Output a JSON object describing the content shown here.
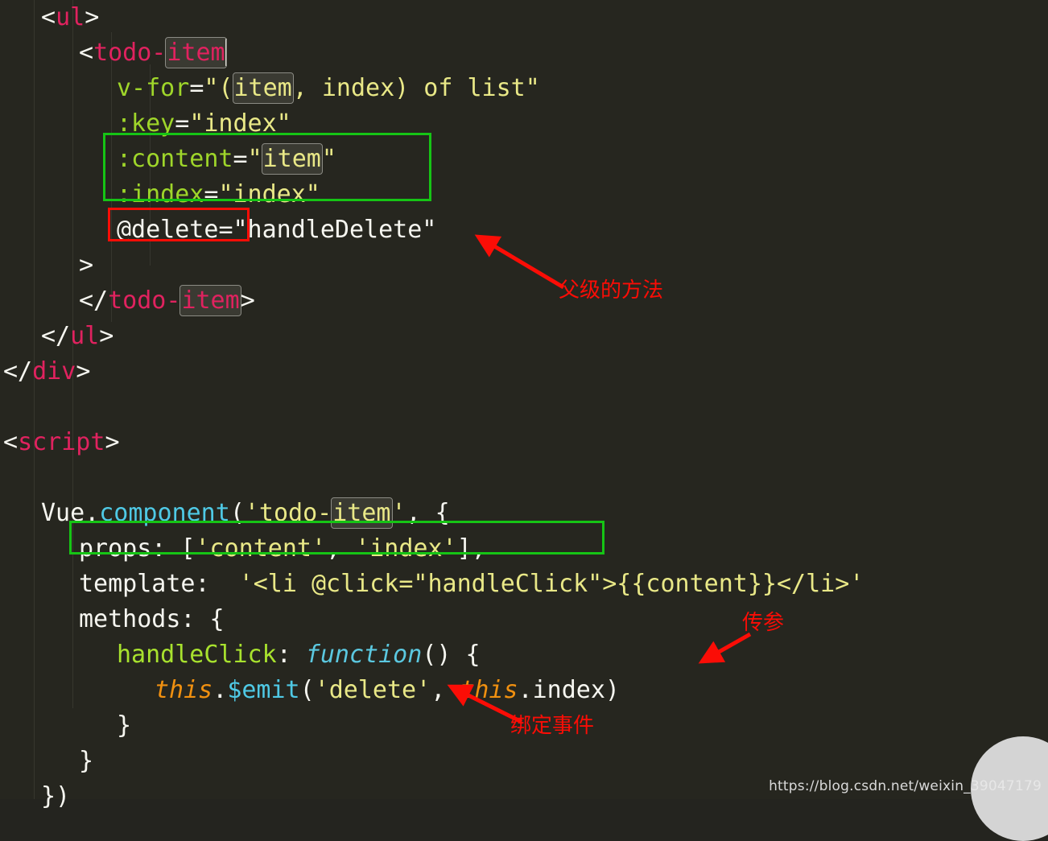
{
  "editor": {
    "background_hex": "#26261f",
    "font_size_px": 30,
    "line_height_px": 44,
    "caret_after_token": "todo-item",
    "occurrence_highlight_token": "item"
  },
  "colors": {
    "tag": "#e0225f",
    "attribute": "#9fd62a",
    "string": "#e9e887",
    "plain": "#f6f6f0",
    "function": "#5fd7e8",
    "keyword_function": "#5bc8e0",
    "this_keyword": "#f09010",
    "method_name": "#a8e22e",
    "annotation_red": "#fb0d06",
    "annotation_green": "#16c415"
  },
  "code_lines": [
    {
      "id": "l1",
      "indent": 1,
      "segments": [
        {
          "t": "<",
          "c": "punc"
        },
        {
          "t": "ul",
          "c": "tag"
        },
        {
          "t": ">",
          "c": "punc"
        }
      ]
    },
    {
      "id": "l2",
      "indent": 2,
      "segments": [
        {
          "t": "<",
          "c": "punc"
        },
        {
          "t": "todo-",
          "c": "tag"
        },
        {
          "t": "item",
          "c": "tag",
          "occ": true
        },
        {
          "t": "|caret|",
          "c": "caret"
        }
      ]
    },
    {
      "id": "l3",
      "indent": 3,
      "segments": [
        {
          "t": "v-for",
          "c": "attr"
        },
        {
          "t": "=",
          "c": "plain"
        },
        {
          "t": "\"(",
          "c": "str"
        },
        {
          "t": "item",
          "c": "str",
          "occ": true
        },
        {
          "t": ", index) of list\"",
          "c": "str"
        }
      ]
    },
    {
      "id": "l4",
      "indent": 3,
      "segments": [
        {
          "t": ":key",
          "c": "attr"
        },
        {
          "t": "=",
          "c": "plain"
        },
        {
          "t": "\"index\"",
          "c": "str"
        }
      ]
    },
    {
      "id": "l5",
      "indent": 3,
      "segments": [
        {
          "t": ":content",
          "c": "attr"
        },
        {
          "t": "=",
          "c": "plain"
        },
        {
          "t": "\"",
          "c": "str"
        },
        {
          "t": "item",
          "c": "str",
          "occ": true
        },
        {
          "t": "\"",
          "c": "str"
        }
      ]
    },
    {
      "id": "l6",
      "indent": 3,
      "segments": [
        {
          "t": ":index",
          "c": "attr"
        },
        {
          "t": "=",
          "c": "plain"
        },
        {
          "t": "\"index\"",
          "c": "str"
        }
      ]
    },
    {
      "id": "l7",
      "indent": 3,
      "segments": [
        {
          "t": "@delete",
          "c": "plain"
        },
        {
          "t": "=\"handleDelete\"",
          "c": "plain"
        }
      ]
    },
    {
      "id": "l8",
      "indent": 2,
      "segments": [
        {
          "t": ">",
          "c": "punc"
        }
      ]
    },
    {
      "id": "l9",
      "indent": 2,
      "segments": [
        {
          "t": "</",
          "c": "punc"
        },
        {
          "t": "todo-",
          "c": "tag"
        },
        {
          "t": "item",
          "c": "tag",
          "occ": true
        },
        {
          "t": ">",
          "c": "punc"
        }
      ]
    },
    {
      "id": "l10",
      "indent": 1,
      "segments": [
        {
          "t": "</",
          "c": "punc"
        },
        {
          "t": "ul",
          "c": "tag"
        },
        {
          "t": ">",
          "c": "punc"
        }
      ]
    },
    {
      "id": "l11",
      "indent": 0,
      "segments": [
        {
          "t": "</",
          "c": "punc"
        },
        {
          "t": "div",
          "c": "tag"
        },
        {
          "t": ">",
          "c": "punc"
        }
      ]
    },
    {
      "id": "l12",
      "indent": 0,
      "segments": []
    },
    {
      "id": "l13",
      "indent": 0,
      "segments": [
        {
          "t": "<",
          "c": "punc"
        },
        {
          "t": "script",
          "c": "tag"
        },
        {
          "t": ">",
          "c": "punc"
        }
      ]
    },
    {
      "id": "l14",
      "indent": 0,
      "segments": []
    },
    {
      "id": "l15",
      "indent": 1,
      "segments": [
        {
          "t": "Vue",
          "c": "plain"
        },
        {
          "t": ".",
          "c": "plain"
        },
        {
          "t": "component",
          "c": "cyan"
        },
        {
          "t": "(",
          "c": "plain"
        },
        {
          "t": "'todo-",
          "c": "str"
        },
        {
          "t": "item",
          "c": "str",
          "occ": true
        },
        {
          "t": "'",
          "c": "str"
        },
        {
          "t": ", {",
          "c": "plain"
        }
      ]
    },
    {
      "id": "l16",
      "indent": 2,
      "segments": [
        {
          "t": "props: ",
          "c": "plain"
        },
        {
          "t": "[",
          "c": "plain"
        },
        {
          "t": "'content'",
          "c": "str"
        },
        {
          "t": ", ",
          "c": "plain"
        },
        {
          "t": "'index'",
          "c": "str"
        },
        {
          "t": "],",
          "c": "plain"
        }
      ]
    },
    {
      "id": "l17",
      "indent": 2,
      "segments": [
        {
          "t": "template:  ",
          "c": "plain"
        },
        {
          "t": "'<li @click=\"handleClick\">{{content}}</li>'",
          "c": "str"
        }
      ]
    },
    {
      "id": "l18",
      "indent": 2,
      "segments": [
        {
          "t": "methods: {",
          "c": "plain"
        }
      ]
    },
    {
      "id": "l19",
      "indent": 3,
      "segments": [
        {
          "t": "handleClick",
          "c": "method"
        },
        {
          "t": ": ",
          "c": "plain"
        },
        {
          "t": "function",
          "c": "kw-fn"
        },
        {
          "t": "() {",
          "c": "plain"
        }
      ]
    },
    {
      "id": "l20",
      "indent": 4,
      "segments": [
        {
          "t": "this",
          "c": "this"
        },
        {
          "t": ".",
          "c": "plain"
        },
        {
          "t": "$emit",
          "c": "cyan"
        },
        {
          "t": "(",
          "c": "plain"
        },
        {
          "t": "'delete'",
          "c": "str"
        },
        {
          "t": ", ",
          "c": "plain"
        },
        {
          "t": "this",
          "c": "this"
        },
        {
          "t": ".index)",
          "c": "plain"
        }
      ]
    },
    {
      "id": "l21",
      "indent": 3,
      "segments": [
        {
          "t": "}",
          "c": "plain"
        }
      ]
    },
    {
      "id": "l22",
      "indent": 2,
      "segments": [
        {
          "t": "}",
          "c": "plain"
        }
      ]
    },
    {
      "id": "l23",
      "indent": 1,
      "segments": [
        {
          "t": "})",
          "c": "plain"
        }
      ]
    }
  ],
  "annotations": [
    {
      "id": "a1",
      "label": "父级的方法",
      "meaning": "parent's method",
      "color": "#fb0d06"
    },
    {
      "id": "a2",
      "label": "传参",
      "meaning": "pass parameter",
      "color": "#fb0d06"
    },
    {
      "id": "a3",
      "label": "绑定事件",
      "meaning": "bind event",
      "color": "#fb0d06"
    }
  ],
  "highlight_boxes": [
    {
      "id": "green-props-binding",
      "color": "#16c415",
      "covers": ":content / :index binding lines"
    },
    {
      "id": "red-delete-event",
      "color": "#fb0d06",
      "covers": "@delete"
    },
    {
      "id": "green-props-array",
      "color": "#16c415",
      "covers": "props: ['content', 'index'],"
    }
  ],
  "watermark": {
    "text": "https://blog.csdn.net/weixin_39047179"
  }
}
